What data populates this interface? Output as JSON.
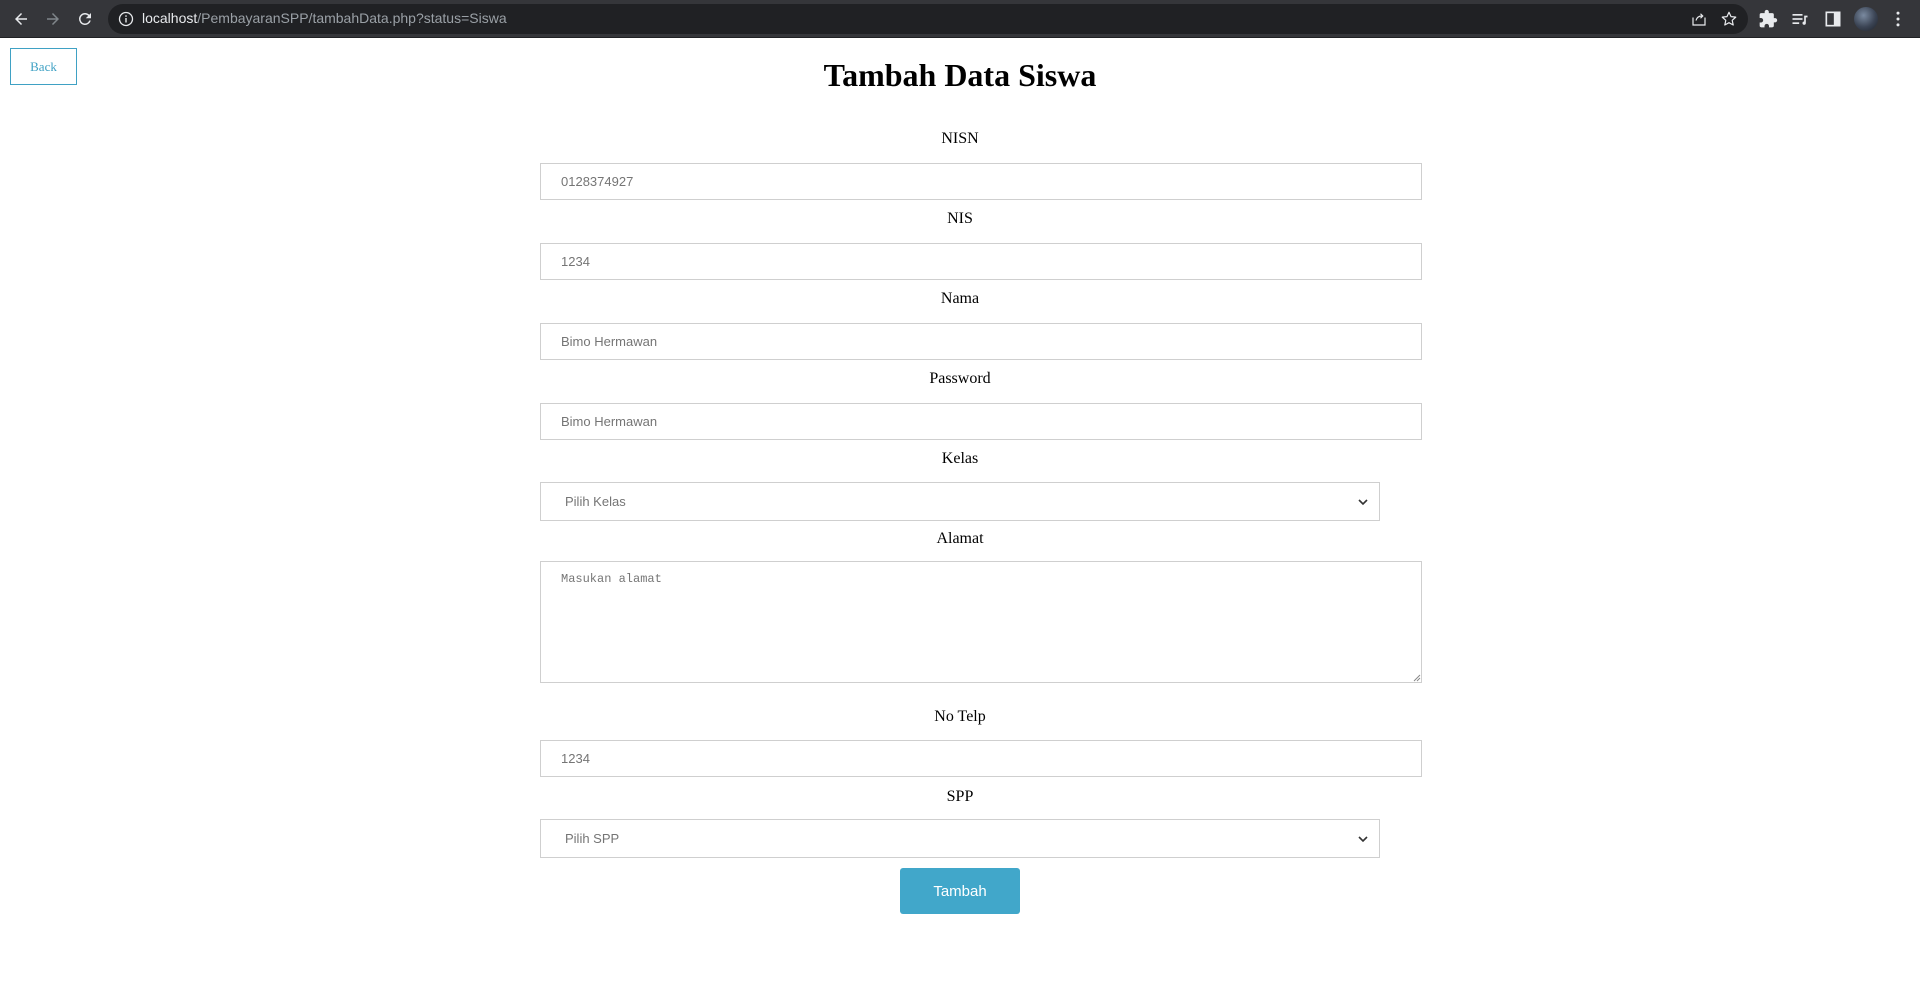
{
  "browser": {
    "url_host": "localhost",
    "url_path": "/PembayaranSPP/tambahData.php?status=Siswa"
  },
  "page": {
    "back_label": "Back",
    "title": "Tambah Data Siswa"
  },
  "form": {
    "nisn": {
      "label": "NISN",
      "placeholder": "0128374927"
    },
    "nis": {
      "label": "NIS",
      "placeholder": "1234"
    },
    "nama": {
      "label": "Nama",
      "placeholder": "Bimo Hermawan"
    },
    "password": {
      "label": "Password",
      "placeholder": "Bimo Hermawan"
    },
    "kelas": {
      "label": "Kelas",
      "selected": "Pilih Kelas"
    },
    "alamat": {
      "label": "Alamat",
      "placeholder": "Masukan alamat"
    },
    "no_telp": {
      "label": "No Telp",
      "placeholder": "1234"
    },
    "spp": {
      "label": "SPP",
      "selected": "Pilih SPP"
    },
    "submit_label": "Tambah"
  },
  "colors": {
    "accent": "#41a7ca",
    "back_border": "#3fa1c4",
    "chrome_bg": "#35363a"
  },
  "icons": {
    "nav": [
      "back-arrow-icon",
      "forward-arrow-icon",
      "reload-icon"
    ],
    "omnibox": [
      "info-icon",
      "share-icon",
      "star-icon"
    ],
    "toolbar": [
      "extensions-icon",
      "reading-list-icon",
      "side-panel-icon",
      "avatar",
      "menu-icon"
    ]
  }
}
